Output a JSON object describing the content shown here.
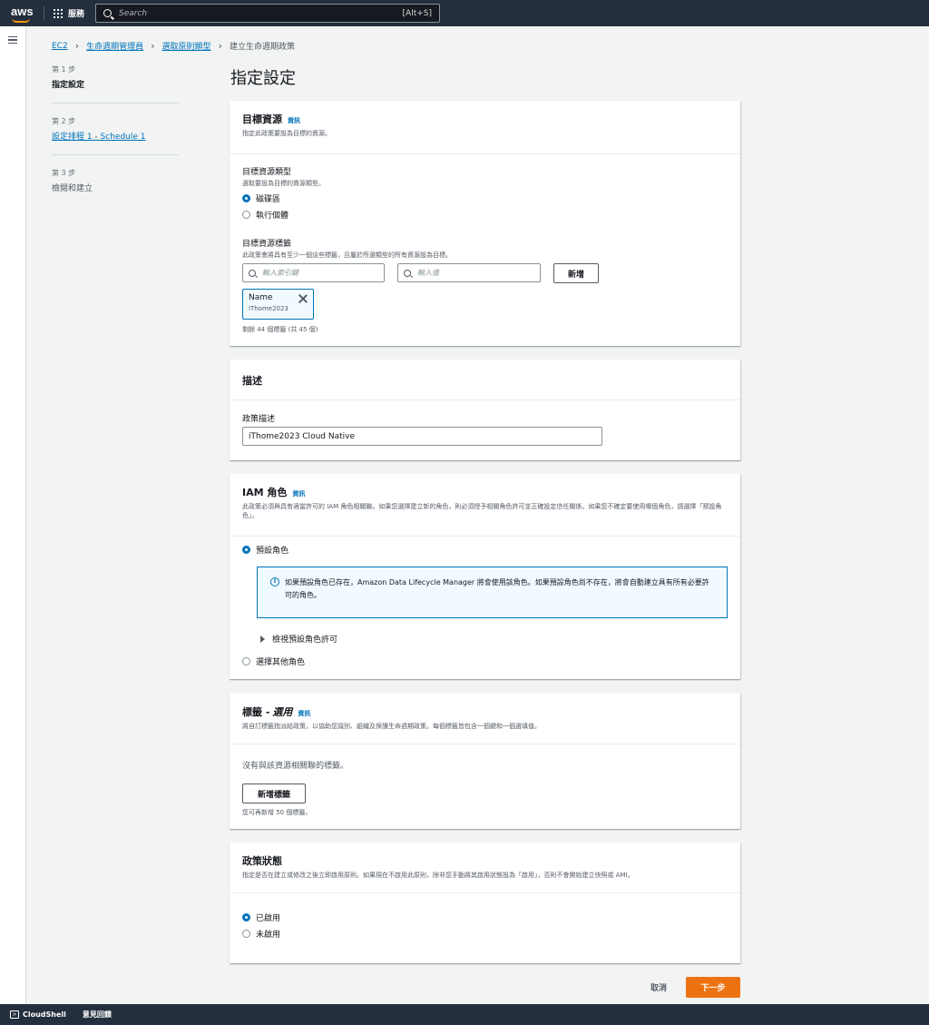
{
  "topnav": {
    "logo": "aws",
    "services_label": "服務",
    "search_placeholder": "Search",
    "search_shortcut": "[Alt+S]"
  },
  "breadcrumb": {
    "items": [
      "EC2",
      "生命週期管理員",
      "選取原則類型"
    ],
    "current": "建立生命週期政策"
  },
  "steps": [
    {
      "num": "第 1 步",
      "title": "指定設定"
    },
    {
      "num": "第 2 步",
      "title": "設定排程 1 - Schedule 1"
    },
    {
      "num": "第 3 步",
      "title": "檢閱和建立"
    }
  ],
  "page_title": "指定設定",
  "target": {
    "title": "目標資源",
    "info": "資訊",
    "desc": "指定此政策要設為目標的資源。",
    "type_label": "目標資源類型",
    "type_desc": "選取要設為目標的資源類型。",
    "type_options": [
      "磁碟區",
      "執行個體"
    ],
    "tags_label": "目標資源標籤",
    "tags_desc": "此政策會將具有至少一個這些標籤，且屬於所選類型的所有資源設為目標。",
    "key_placeholder": "輸入索引鍵",
    "value_placeholder": "輸入值",
    "add_button": "新增",
    "token_key": "Name",
    "token_value": "iThome2023",
    "remaining": "剩餘 44 個標籤 (共 45 個)"
  },
  "description": {
    "title": "描述",
    "label": "政策描述",
    "value": "iThome2023 Cloud Native"
  },
  "iam": {
    "title": "IAM 角色",
    "info": "資訊",
    "desc": "此政策必須與具有適當許可的 IAM 角色相關聯。如果您選擇建立新的角色，則必須授予相關角色許可並正確設定信任關係。如果您不確定要使用哪個角色，請選擇「預設角色」。",
    "option_default": "預設角色",
    "alert": "如果預設角色已存在，Amazon Data Lifecycle Manager 將會使用該角色。如果預設角色尚不存在，將會自動建立具有所有必要許可的角色。",
    "expander": "檢視預設角色許可",
    "option_other": "選擇其他角色"
  },
  "tags": {
    "title": "標籤 - ",
    "title_optional": "選用",
    "info": "資訊",
    "desc": "將自訂標籤指派給政策，以協助您識別、組織及保護生命週期政策。每個標籤皆包含一個鍵和一個選填值。",
    "empty": "沒有與該資源相關聯的標籤。",
    "add_button": "新增標籤",
    "remaining": "您可再新增 50 個標籤。"
  },
  "status": {
    "title": "政策狀態",
    "desc": "指定是否在建立或修改之後立即啟用原則。如果現在不啟用此原則，除非您手動將其啟用狀態設為「啟用」，否則不會開始建立快照或 AMI。",
    "options": [
      "已啟用",
      "未啟用"
    ]
  },
  "actions": {
    "cancel": "取消",
    "next": "下一步"
  },
  "bottombar": {
    "cloudshell": "CloudShell",
    "feedback": "意見回饋"
  },
  "colors": {
    "nav_bg": "#232f3e",
    "link": "#0073bb",
    "primary": "#ec7211",
    "page_bg": "#f2f3f3"
  }
}
